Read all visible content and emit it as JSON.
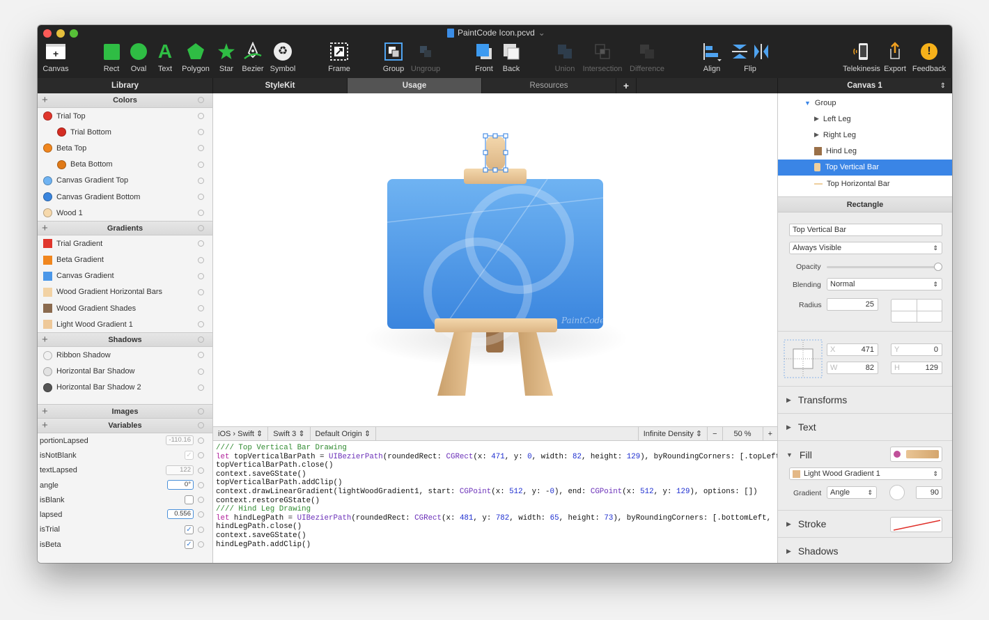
{
  "window": {
    "title": "PaintCode Icon.pcvd",
    "title_chevron": "⌄"
  },
  "toolbar": {
    "items": [
      {
        "label": "Canvas",
        "icon": "canvas-icon"
      },
      {
        "label": "Rect",
        "icon": "rect-icon"
      },
      {
        "label": "Oval",
        "icon": "oval-icon"
      },
      {
        "label": "Text",
        "icon": "text-icon"
      },
      {
        "label": "Polygon",
        "icon": "polygon-icon"
      },
      {
        "label": "Star",
        "icon": "star-icon"
      },
      {
        "label": "Bezier",
        "icon": "bezier-icon"
      },
      {
        "label": "Symbol",
        "icon": "symbol-icon"
      },
      {
        "label": "Frame",
        "icon": "frame-icon"
      },
      {
        "label": "Group",
        "icon": "group-icon"
      },
      {
        "label": "Ungroup",
        "icon": "ungroup-icon",
        "disabled": true
      },
      {
        "label": "Front",
        "icon": "front-icon"
      },
      {
        "label": "Back",
        "icon": "back-icon"
      },
      {
        "label": "Union",
        "icon": "union-icon",
        "disabled": true
      },
      {
        "label": "Intersection",
        "icon": "intersection-icon",
        "disabled": true
      },
      {
        "label": "Difference",
        "icon": "difference-icon",
        "disabled": true
      },
      {
        "label": "Align",
        "icon": "align-icon"
      },
      {
        "label": "Flip",
        "icon": "flip-icon"
      },
      {
        "label": "Telekinesis",
        "icon": "telekinesis-icon"
      },
      {
        "label": "Export",
        "icon": "export-icon"
      },
      {
        "label": "Feedback",
        "icon": "feedback-icon"
      }
    ],
    "text_glyph": "A",
    "plus_glyph": "+",
    "symbol_glyph": "♻",
    "feedback_glyph": "!"
  },
  "tabs": {
    "library": "Library",
    "stylekit": "StyleKit",
    "usage": "Usage",
    "resources": "Resources",
    "add": "+",
    "canvas_select": "Canvas 1",
    "canvas_select_arrow": "⇕"
  },
  "library": {
    "colors_title": "Colors",
    "colors": [
      {
        "name": "Trial Top",
        "color": "#e0362c",
        "indent": false
      },
      {
        "name": "Trial Bottom",
        "color": "#d42c22",
        "indent": true
      },
      {
        "name": "Beta Top",
        "color": "#f0861e",
        "indent": false
      },
      {
        "name": "Beta Bottom",
        "color": "#e07a18",
        "indent": true
      },
      {
        "name": "Canvas Gradient Top",
        "color": "#6fb3f2",
        "indent": false
      },
      {
        "name": "Canvas Gradient Bottom",
        "color": "#3a85de",
        "indent": false
      },
      {
        "name": "Wood 1",
        "color": "#f6d9ac",
        "indent": false
      }
    ],
    "gradients_title": "Gradients",
    "gradients": [
      {
        "name": "Trial Gradient",
        "color": "#e0362c"
      },
      {
        "name": "Beta Gradient",
        "color": "#f0861e"
      },
      {
        "name": "Canvas Gradient",
        "color": "#4b97e8"
      },
      {
        "name": "Wood Gradient Horizontal Bars",
        "color": "#f2d2a4"
      },
      {
        "name": "Wood Gradient Shades",
        "color": "#8a6a4e"
      },
      {
        "name": "Light Wood Gradient 1",
        "color": "#eec898"
      }
    ],
    "shadows_title": "Shadows",
    "shadows": [
      {
        "name": "Ribbon Shadow",
        "color": "#f1f1f1"
      },
      {
        "name": "Horizontal Bar Shadow",
        "color": "#e2e2e2"
      },
      {
        "name": "Horizontal Bar Shadow 2",
        "color": "#555555"
      }
    ],
    "images_title": "Images",
    "variables_title": "Variables",
    "variables": [
      {
        "name": "portionLapsed",
        "value": "-110.16",
        "kind": "num"
      },
      {
        "name": "isNotBlank",
        "value": "✓",
        "kind": "chkdim"
      },
      {
        "name": "textLapsed",
        "value": "122",
        "kind": "num"
      },
      {
        "name": "angle",
        "value": "0°",
        "kind": "numact"
      },
      {
        "name": "isBlank",
        "value": "",
        "kind": "chk"
      },
      {
        "name": "lapsed",
        "value": "0.556",
        "kind": "numact"
      },
      {
        "name": "isTrial",
        "value": "✓",
        "kind": "chk"
      },
      {
        "name": "isBeta",
        "value": "✓",
        "kind": "chk"
      }
    ]
  },
  "codebar": {
    "platform": "iOS › Swift",
    "swift": "Swift 3",
    "origin": "Default Origin",
    "density": "Infinite Density",
    "minus": "−",
    "zoom": "50 %",
    "plus": "+"
  },
  "code_lines": [
    "//// Top Vertical Bar Drawing",
    "let topVerticalBarPath = UIBezierPath(roundedRect: CGRect(x: 471, y: 0, width: 82, height: 129), byRoundingCorners: [.topLeft, .topRi",
    "topVerticalBarPath.close()",
    "context.saveGState()",
    "topVerticalBarPath.addClip()",
    "context.drawLinearGradient(lightWoodGradient1, start: CGPoint(x: 512, y: -0), end: CGPoint(x: 512, y: 129), options: [])",
    "context.restoreGState()",
    "",
    "",
    "//// Hind Leg Drawing",
    "let hindLegPath = UIBezierPath(roundedRect: CGRect(x: 481, y: 782, width: 65, height: 73), byRoundingCorners: [.bottomLeft, .bottomR",
    "hindLegPath.close()",
    "context.saveGState()",
    "hindLegPath.addClip()"
  ],
  "tree": {
    "items": [
      {
        "label": "Group",
        "icon": "tri-down",
        "level": 0
      },
      {
        "label": "Left Leg",
        "icon": "tri-right",
        "level": 1
      },
      {
        "label": "Right Leg",
        "icon": "tri-right",
        "level": 1
      },
      {
        "label": "Hind Leg",
        "icon": "swatch-dark",
        "level": 1
      },
      {
        "label": "Top Vertical Bar",
        "icon": "swatch-light",
        "level": 1,
        "selected": true
      },
      {
        "label": "Top Horizontal Bar",
        "icon": "line",
        "level": 1
      }
    ]
  },
  "inspector": {
    "title": "Rectangle",
    "name": "Top Vertical Bar",
    "visibility": "Always Visible",
    "opacity_label": "Opacity",
    "blending_label": "Blending",
    "blending": "Normal",
    "radius_label": "Radius",
    "radius": "25",
    "x_label": "X",
    "x": "471",
    "y_label": "Y",
    "y": "0",
    "w_label": "W",
    "w": "82",
    "h_label": "H",
    "h": "129",
    "dropdown_arrow": "⇕"
  },
  "sections": {
    "transforms": "Transforms",
    "text": "Text",
    "fill": "Fill",
    "fill_gradient": "Light Wood Gradient 1",
    "gradient_label": "Gradient",
    "gradient_type": "Angle",
    "gradient_angle": "90",
    "stroke": "Stroke",
    "shadows": "Shadows"
  },
  "signature": "PaintCode"
}
